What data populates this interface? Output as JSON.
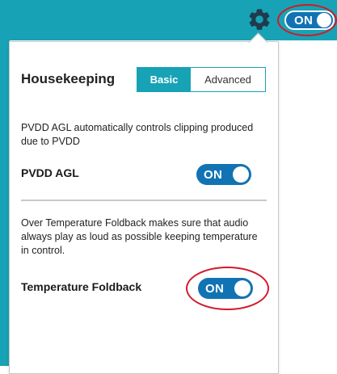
{
  "top_bar": {
    "accent_color": "#17a3b5",
    "settings_icon": "gear-icon",
    "master_toggle": {
      "label": "ON",
      "state": "on",
      "highlighted": true
    }
  },
  "panel": {
    "heading": "Housekeeping",
    "mode_tabs": [
      {
        "label": "Basic",
        "selected": true
      },
      {
        "label": "Advanced",
        "selected": false
      }
    ],
    "settings": [
      {
        "description": "PVDD AGL automatically controls clipping produced due to PVDD",
        "label": "PVDD AGL",
        "toggle_label": "ON",
        "state": "on",
        "highlighted": false
      },
      {
        "description": "Over Temperature Foldback makes sure that audio always play as loud as possible keeping temperature in control.",
        "label": "Temperature Foldback",
        "toggle_label": "ON",
        "state": "on",
        "highlighted": true
      }
    ]
  },
  "colors": {
    "toggle_on": "#1173b4",
    "highlight_ring": "#d11a2a",
    "divider": "#c8c8c8"
  }
}
